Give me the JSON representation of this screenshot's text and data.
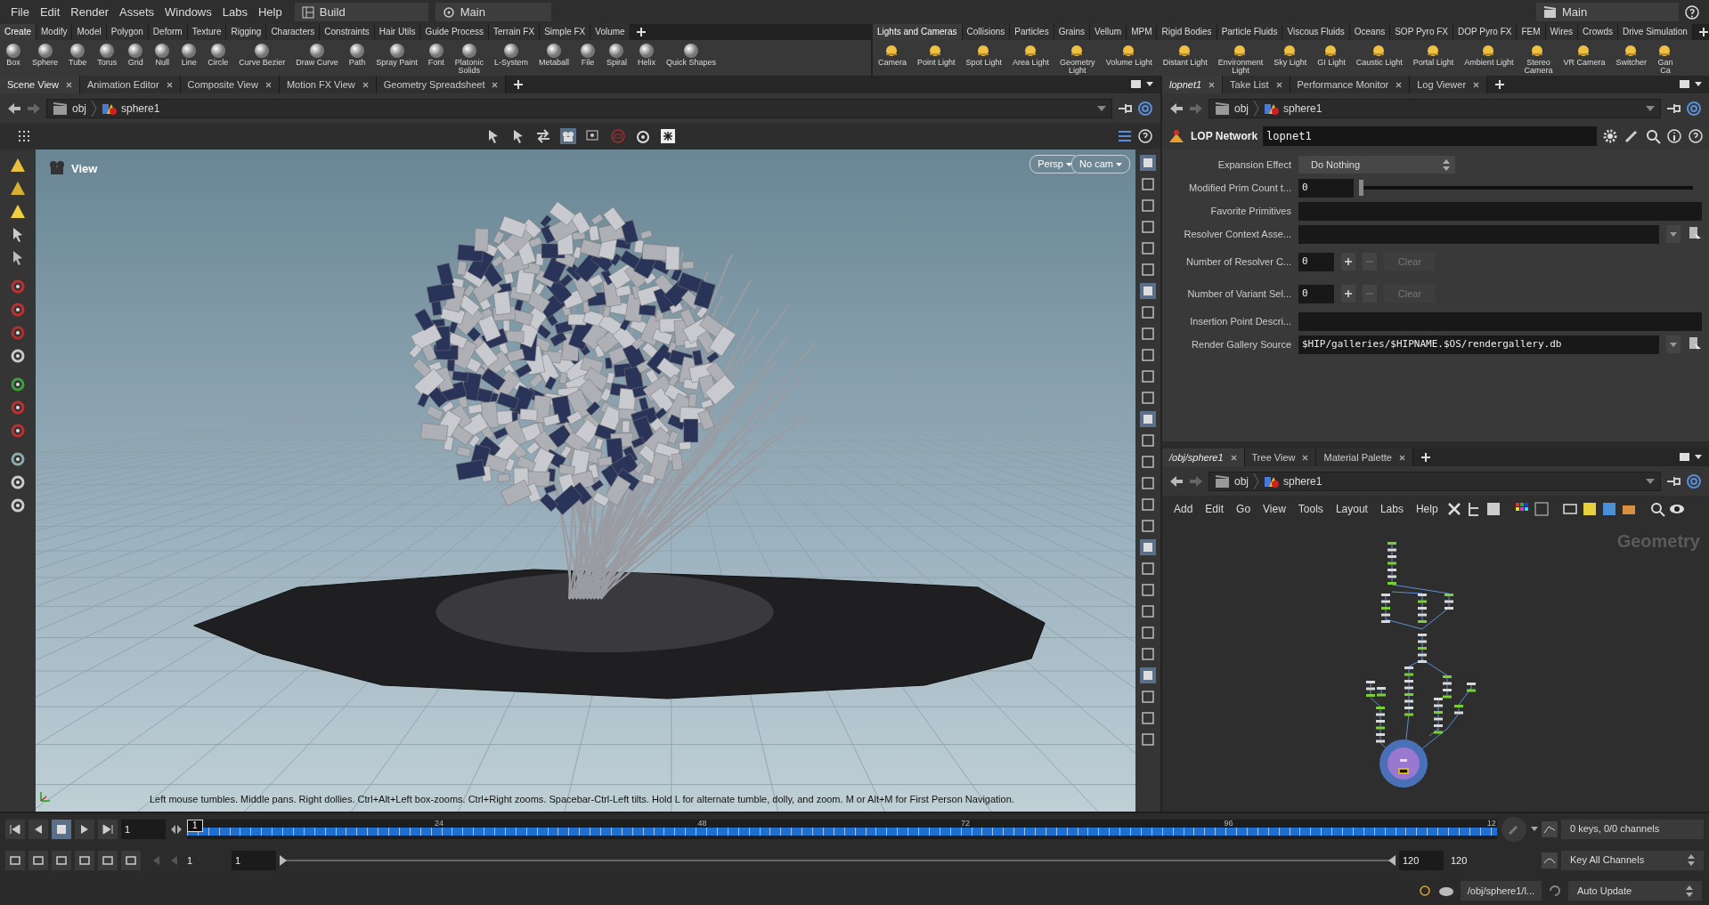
{
  "menu_bar": {
    "items": [
      "File",
      "Edit",
      "Render",
      "Assets",
      "Windows",
      "Labs",
      "Help"
    ],
    "desktop": "Build",
    "context": "Main",
    "right_context": "Main"
  },
  "shelf_left": {
    "tabs": [
      {
        "label": "Create",
        "selected": true
      },
      {
        "label": "Modify",
        "selected": false
      },
      {
        "label": "Model",
        "selected": false
      },
      {
        "label": "Polygon",
        "selected": false
      },
      {
        "label": "Deform",
        "selected": false
      },
      {
        "label": "Texture",
        "selected": false
      },
      {
        "label": "Rigging",
        "selected": false
      },
      {
        "label": "Characters",
        "selected": false
      },
      {
        "label": "Constraints",
        "selected": false
      },
      {
        "label": "Hair Utils",
        "selected": false
      },
      {
        "label": "Guide Process",
        "selected": false
      },
      {
        "label": "Terrain FX",
        "selected": false
      },
      {
        "label": "Simple FX",
        "selected": false
      },
      {
        "label": "Volume",
        "selected": false
      }
    ],
    "tools": [
      "Box",
      "Sphere",
      "Tube",
      "Torus",
      "Grid",
      "Null",
      "Line",
      "Circle",
      "Curve Bezier",
      "Draw Curve",
      "Path",
      "Spray Paint",
      "Font",
      "Platonic\nSolids",
      "L-System",
      "Metaball",
      "File",
      "Spiral",
      "Helix",
      "Quick Shapes"
    ]
  },
  "shelf_right": {
    "tabs": [
      {
        "label": "Lights and Cameras",
        "selected": true
      },
      {
        "label": "Collisions",
        "selected": false
      },
      {
        "label": "Particles",
        "selected": false
      },
      {
        "label": "Grains",
        "selected": false
      },
      {
        "label": "Vellum",
        "selected": false
      },
      {
        "label": "MPM",
        "selected": false
      },
      {
        "label": "Rigid Bodies",
        "selected": false
      },
      {
        "label": "Particle Fluids",
        "selected": false
      },
      {
        "label": "Viscous Fluids",
        "selected": false
      },
      {
        "label": "Oceans",
        "selected": false
      },
      {
        "label": "SOP Pyro FX",
        "selected": false
      },
      {
        "label": "DOP Pyro FX",
        "selected": false
      },
      {
        "label": "FEM",
        "selected": false
      },
      {
        "label": "Wires",
        "selected": false
      },
      {
        "label": "Crowds",
        "selected": false
      },
      {
        "label": "Drive Simulation",
        "selected": false
      }
    ],
    "tools": [
      "Camera",
      "Point Light",
      "Spot Light",
      "Area Light",
      "Geometry\nLight",
      "Volume Light",
      "Distant Light",
      "Environment\nLight",
      "Sky Light",
      "GI Light",
      "Caustic Light",
      "Portal Light",
      "Ambient Light",
      "Stereo\nCamera",
      "VR Camera",
      "Switcher",
      "Gan\nCa"
    ]
  },
  "scene_pane": {
    "tabs": [
      {
        "label": "Scene View",
        "selected": true
      },
      {
        "label": "Animation Editor",
        "selected": false
      },
      {
        "label": "Composite View",
        "selected": false
      },
      {
        "label": "Motion FX View",
        "selected": false
      },
      {
        "label": "Geometry Spreadsheet",
        "selected": false
      }
    ],
    "path": [
      "obj",
      "sphere1"
    ],
    "viewport": {
      "title": "View",
      "projection": "Persp",
      "camera": "No cam",
      "hint": "Left mouse tumbles. Middle pans. Right dollies. Ctrl+Alt+Left box-zooms. Ctrl+Right zooms. Spacebar-Ctrl-Left tilts. Hold L for alternate tumble, dolly, and zoom. M or Alt+M for First Person Navigation."
    }
  },
  "parameter_pane": {
    "tabs": [
      {
        "label": "lopnet1",
        "selected": true
      },
      {
        "label": "Take List",
        "selected": false
      },
      {
        "label": "Performance Monitor",
        "selected": false
      },
      {
        "label": "Log Viewer",
        "selected": false
      }
    ],
    "path": [
      "obj",
      "sphere1"
    ],
    "node_type": "LOP Network",
    "node_name": "lopnet1",
    "parameters": [
      {
        "kind": "menu",
        "label": "Expansion Effect",
        "value": "Do Nothing"
      },
      {
        "kind": "slider",
        "label": "Modified Prim Count t...",
        "value": "0",
        "level": 0
      },
      {
        "kind": "string",
        "label": "Favorite Primitives"
      },
      {
        "kind": "file",
        "label": "Resolver Context Asse..."
      },
      {
        "kind": "multiparm",
        "label": "Number of Resolver C...",
        "value": "0",
        "button": "Clear",
        "disabled": true
      },
      {
        "kind": "multiparm",
        "label": "Number of Variant Sel...",
        "value": "0",
        "button": "Clear",
        "disabled": true
      },
      {
        "kind": "string",
        "label": "Insertion Point Descri..."
      },
      {
        "kind": "file",
        "label": "Render Gallery Source",
        "value": "$HIP/galleries/$HIPNAME.$OS/rendergallery.db"
      }
    ]
  },
  "network_pane": {
    "tabs": [
      {
        "label": "/obj/sphere1",
        "selected": true
      },
      {
        "label": "Tree View",
        "selected": false
      },
      {
        "label": "Material Palette",
        "selected": false
      }
    ],
    "path": [
      "obj",
      "sphere1"
    ],
    "menu": [
      "Add",
      "Edit",
      "Go",
      "View",
      "Tools",
      "Layout",
      "Labs",
      "Help"
    ],
    "context_label": "Geometry"
  },
  "timeline": {
    "current_frame": "1",
    "frame_marker": "1",
    "ruler_labels": [
      "24",
      "48",
      "72",
      "96",
      "12"
    ],
    "start": "1",
    "range_start": "1",
    "range_end": "120",
    "end": "120",
    "keys_info": "0 keys, 0/0 channels",
    "key_mode": "Key All Channels"
  },
  "status_bar": {
    "path": "/obj/sphere1/l...",
    "update_mode": "Auto Update"
  }
}
